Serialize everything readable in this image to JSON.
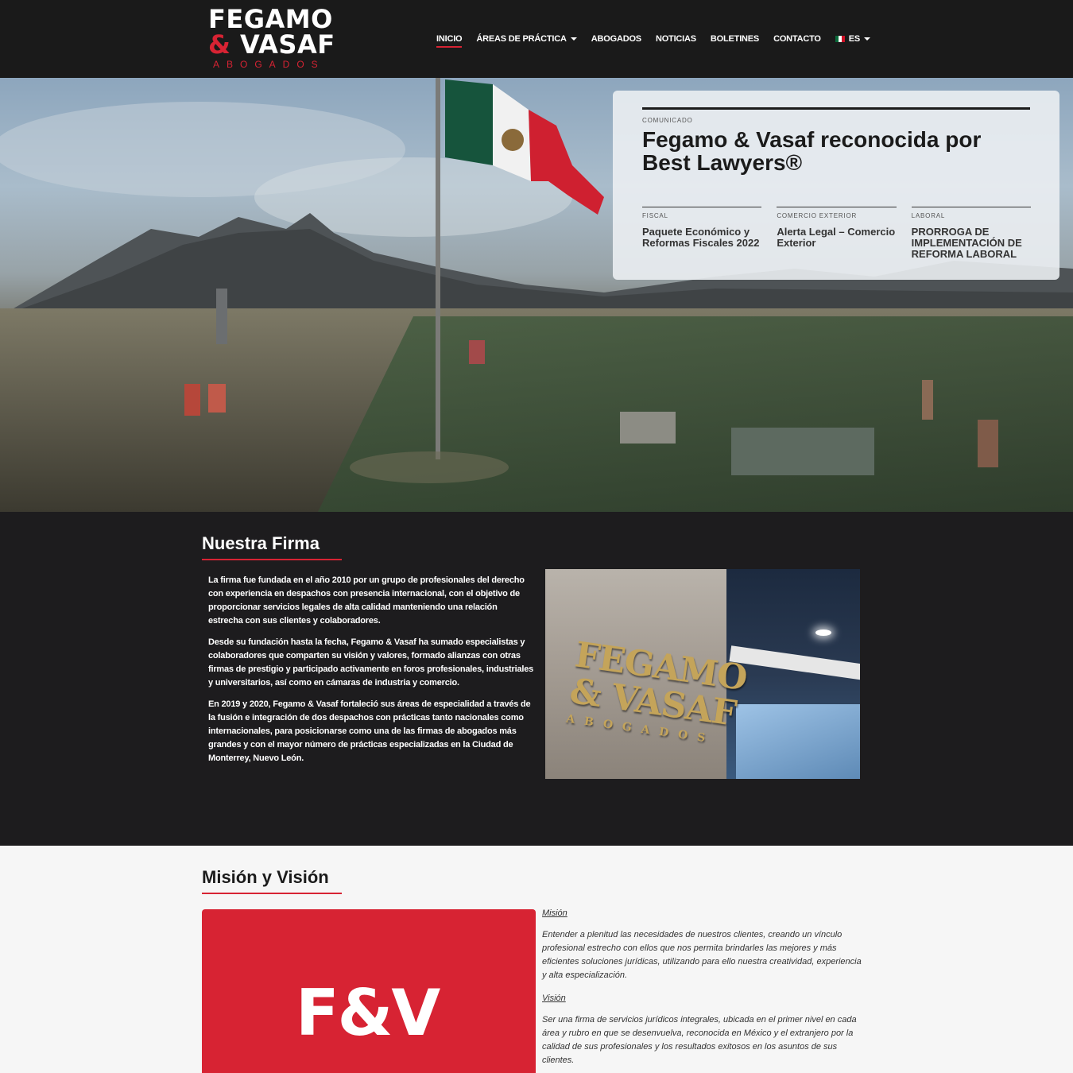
{
  "header": {
    "logo": {
      "line1": "FEGAMO",
      "amp": "&",
      "line2": " VASAF",
      "line3": "ABOGADOS"
    },
    "nav": [
      {
        "label": "INICIO"
      },
      {
        "label": "ÁREAS DE PRÁCTICA"
      },
      {
        "label": "ABOGADOS"
      },
      {
        "label": "NOTICIAS"
      },
      {
        "label": "BOLETINES"
      },
      {
        "label": "CONTACTO"
      },
      {
        "label": "ES"
      }
    ]
  },
  "hero": {
    "featured": {
      "kicker": "COMUNICADO",
      "headline": "Fegamo & Vasaf reconocida por Best Lawyers®"
    },
    "items": [
      {
        "category": "FISCAL",
        "title": "Paquete Económico y Reformas Fiscales 2022"
      },
      {
        "category": "COMERCIO EXTERIOR",
        "title": "Alerta Legal – Comercio Exterior"
      },
      {
        "category": "LABORAL",
        "title": "PRORROGA DE IMPLEMENTACIÓN DE REFORMA LABORAL"
      }
    ]
  },
  "firma": {
    "title": "Nuestra Firma",
    "paragraphs": [
      "La firma fue fundada en el año 2010 por un grupo de profesionales del derecho con experiencia en despachos con presencia internacional, con el objetivo de proporcionar servicios legales de alta calidad manteniendo una relación estrecha con sus clientes y colaboradores.",
      "Desde su fundación hasta la fecha, Fegamo & Vasaf ha sumado especialistas y colaboradores que comparten su visión y valores, formado alianzas con otras firmas de prestigio y participado activamente en foros profesionales, industriales y universitarios, así como en cámaras de industria y comercio.",
      "En 2019 y 2020, Fegamo & Vasaf fortaleció sus áreas de especialidad a través de la fusión e integración de dos despachos con prácticas tanto nacionales como internacionales, para posicionarse como una de las firmas de abogados más grandes y con el mayor número de prácticas especializadas en la Ciudad de Monterrey, Nuevo León."
    ],
    "sign": {
      "line1": "FEGAMO",
      "line2": "& VASAF",
      "line3": "ABOGADOS"
    }
  },
  "mision": {
    "title": "Misión y Visión",
    "logo_text": "F&V",
    "mision_heading": "Misión",
    "mision_text": "Entender a plenitud las necesidades de nuestros clientes, creando un vínculo profesional estrecho con ellos que nos permita brindarles las mejores y más eficientes soluciones jurídicas, utilizando para ello nuestra creatividad, experiencia y alta especialización.",
    "vision_heading": "Visión",
    "vision_text": "Ser una firma de servicios jurídicos integrales, ubicada en el primer nivel en cada área y rubro en que se desenvuelva, reconocida en México y el extranjero por la calidad de sus profesionales y los resultados exitosos en los asuntos de sus clientes."
  },
  "colors": {
    "brand_red": "#d72333",
    "header_bg": "#1a1a1a",
    "firma_bg": "#1d1c1e",
    "light_bg": "#f6f6f6"
  },
  "icons": [
    "caret-down-icon",
    "mexico-flag-icon"
  ]
}
